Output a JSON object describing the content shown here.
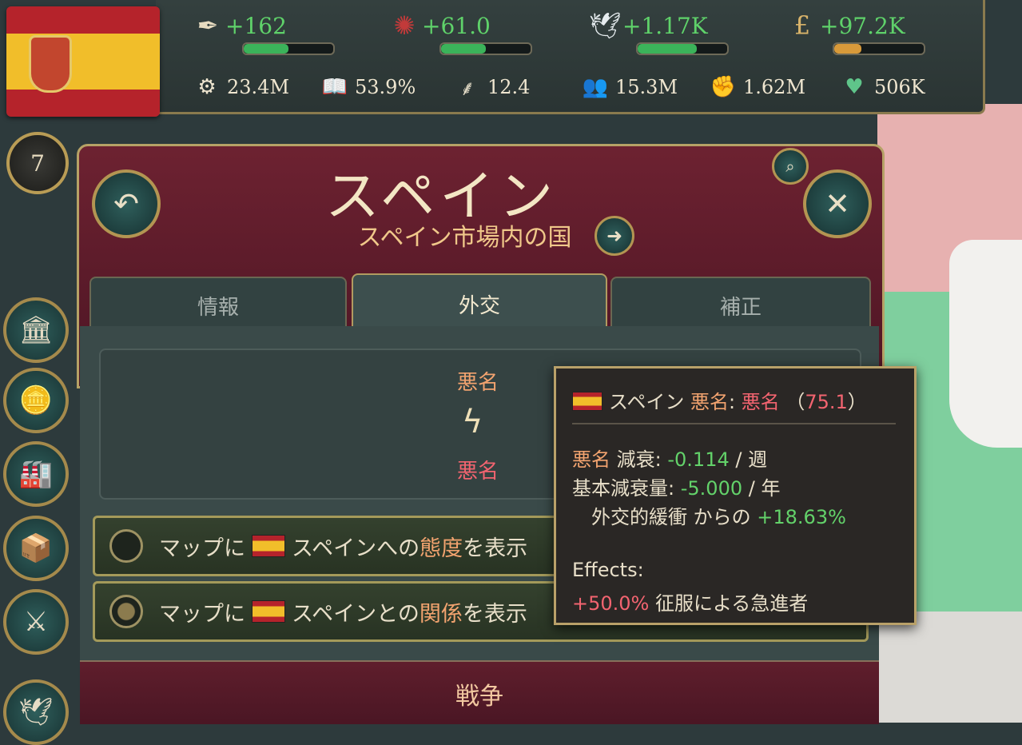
{
  "country": {
    "name": "スペイン",
    "subtitle": "スペイン市場内の国",
    "rank": "7"
  },
  "resources": [
    {
      "icon": "quill-icon",
      "value": "+162",
      "fill": 0.5
    },
    {
      "icon": "wax-seal-icon",
      "value": "+61.0",
      "fill": 0.5
    },
    {
      "icon": "dove-icon",
      "value": "+1.17K",
      "fill": 0.66
    },
    {
      "icon": "pound-icon",
      "value": "+97.2K",
      "fill": 0.3
    }
  ],
  "stats": [
    {
      "icon": "gdp-gear-icon",
      "value": "23.4M"
    },
    {
      "icon": "literacy-book-icon",
      "value": "53.9%"
    },
    {
      "icon": "wheat-icon",
      "value": "12.4"
    },
    {
      "icon": "population-icon",
      "value": "15.3M"
    },
    {
      "icon": "fist-icon",
      "value": "1.62M"
    },
    {
      "icon": "heart-icon",
      "value": "506K"
    }
  ],
  "tabs": [
    {
      "label": "情報",
      "active": false
    },
    {
      "label": "外交",
      "active": true
    },
    {
      "label": "補正",
      "active": false
    }
  ],
  "infamy": {
    "label_top": "悪名",
    "label_bottom": "悪名"
  },
  "map_rows": [
    {
      "prefix": "マップに",
      "country": "スペイン",
      "mid": "への",
      "highlight": "態度",
      "suffix": "を表示"
    },
    {
      "prefix": "マップに",
      "country": "スペイン",
      "mid": "との",
      "highlight": "関係",
      "suffix": "を表示"
    }
  ],
  "war_label": "戦争",
  "tooltip": {
    "country": "スペイン",
    "infamy_word": "悪名",
    "colon": ":",
    "infamy_word2": "悪名",
    "value": "75.1",
    "decay_label": "悪名",
    "decay_word": "減衰:",
    "decay_value": "-0.114",
    "decay_unit": "/ 週",
    "base_label": "基本減衰量:",
    "base_value": "-5.000",
    "base_unit": "/ 年",
    "diplo_label": "外交的緩衝 からの",
    "diplo_value": "+18.63%",
    "effects_label": "Effects:",
    "effect_value": "+50.0%",
    "effect_text": "征服による急進者"
  },
  "colors": {
    "positive": "#63d26a",
    "negative": "#f36470",
    "infamy": "#f2a36f",
    "panel_header": "#6d2231"
  }
}
